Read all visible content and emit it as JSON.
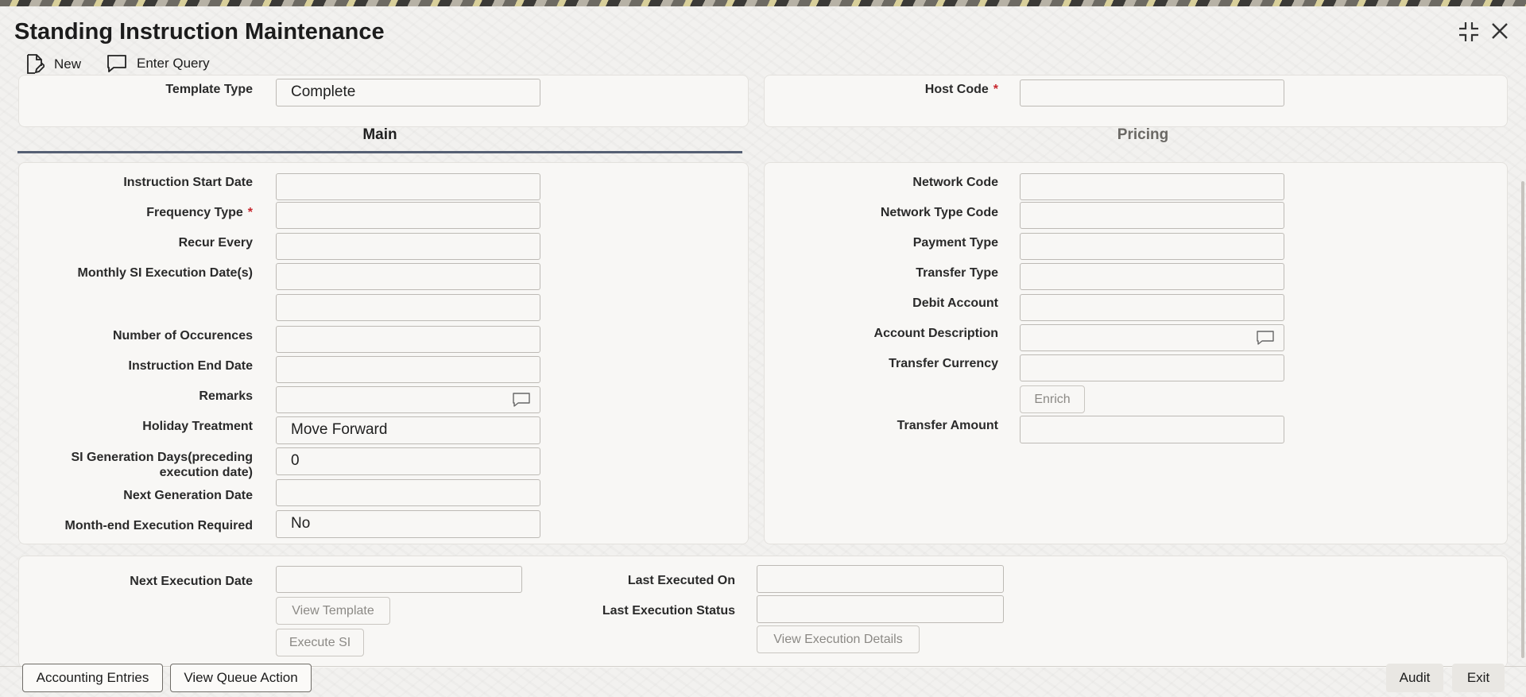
{
  "window": {
    "title": "Standing Instruction Maintenance",
    "minimize_icon": "collapse-icon",
    "close_icon": "close-icon"
  },
  "toolbar": {
    "new_label": "New",
    "new_icon": "new-document-icon",
    "query_label": "Enter Query",
    "query_icon": "chat-bubble-icon"
  },
  "header": {
    "template_type_label": "Template Type",
    "template_type_value": "Complete",
    "host_code_label": "Host Code",
    "required_mark": "*"
  },
  "tabs": [
    {
      "label": "Main",
      "active": true
    },
    {
      "label": "Pricing",
      "active": false
    }
  ],
  "main_left": {
    "instruction_start_date": {
      "label": "Instruction Start Date",
      "value": ""
    },
    "frequency_type": {
      "label": "Frequency Type",
      "value": ""
    },
    "recur_every": {
      "label": "Recur Every",
      "value": ""
    },
    "monthly_si_execution_dates": {
      "label": "Monthly SI Execution Date(s)",
      "value": "",
      "value2": ""
    },
    "number_of_occurences": {
      "label": "Number of Occurences",
      "value": ""
    },
    "instruction_end_date": {
      "label": "Instruction End Date",
      "value": ""
    },
    "remarks": {
      "label": "Remarks",
      "value": ""
    },
    "holiday_treatment": {
      "label": "Holiday Treatment",
      "value": "Move Forward"
    },
    "si_generation_days": {
      "label_line1": "SI Generation Days(preceding",
      "label_line2": "execution date)",
      "value": "0"
    },
    "next_generation_date": {
      "label": "Next Generation Date",
      "value": ""
    },
    "month_end_execution_required": {
      "label": "Month-end Execution Required",
      "value": "No"
    }
  },
  "main_right": {
    "network_code": {
      "label": "Network Code",
      "value": ""
    },
    "network_type_code": {
      "label": "Network Type Code",
      "value": ""
    },
    "payment_type": {
      "label": "Payment Type",
      "value": ""
    },
    "transfer_type": {
      "label": "Transfer Type",
      "value": ""
    },
    "debit_account": {
      "label": "Debit Account",
      "value": ""
    },
    "account_description": {
      "label": "Account Description",
      "value": ""
    },
    "transfer_currency": {
      "label": "Transfer Currency",
      "value": ""
    },
    "enrich_label": "Enrich",
    "transfer_amount": {
      "label": "Transfer Amount",
      "value": ""
    }
  },
  "execution": {
    "next_execution_date": {
      "label": "Next Execution Date",
      "value": ""
    },
    "view_template_label": "View Template",
    "execute_si_label": "Execute SI",
    "last_executed_on": {
      "label": "Last Executed On",
      "value": ""
    },
    "last_execution_status": {
      "label": "Last Execution Status",
      "value": ""
    },
    "view_execution_details_label": "View Execution Details"
  },
  "footer": {
    "accounting_entries_label": "Accounting Entries",
    "view_queue_action_label": "View Queue Action",
    "audit_label": "Audit",
    "exit_label": "Exit"
  },
  "colors": {
    "required": "#c7262d",
    "active_tab_underline": "#555f73",
    "panel_bg": "#f8f7f5"
  }
}
